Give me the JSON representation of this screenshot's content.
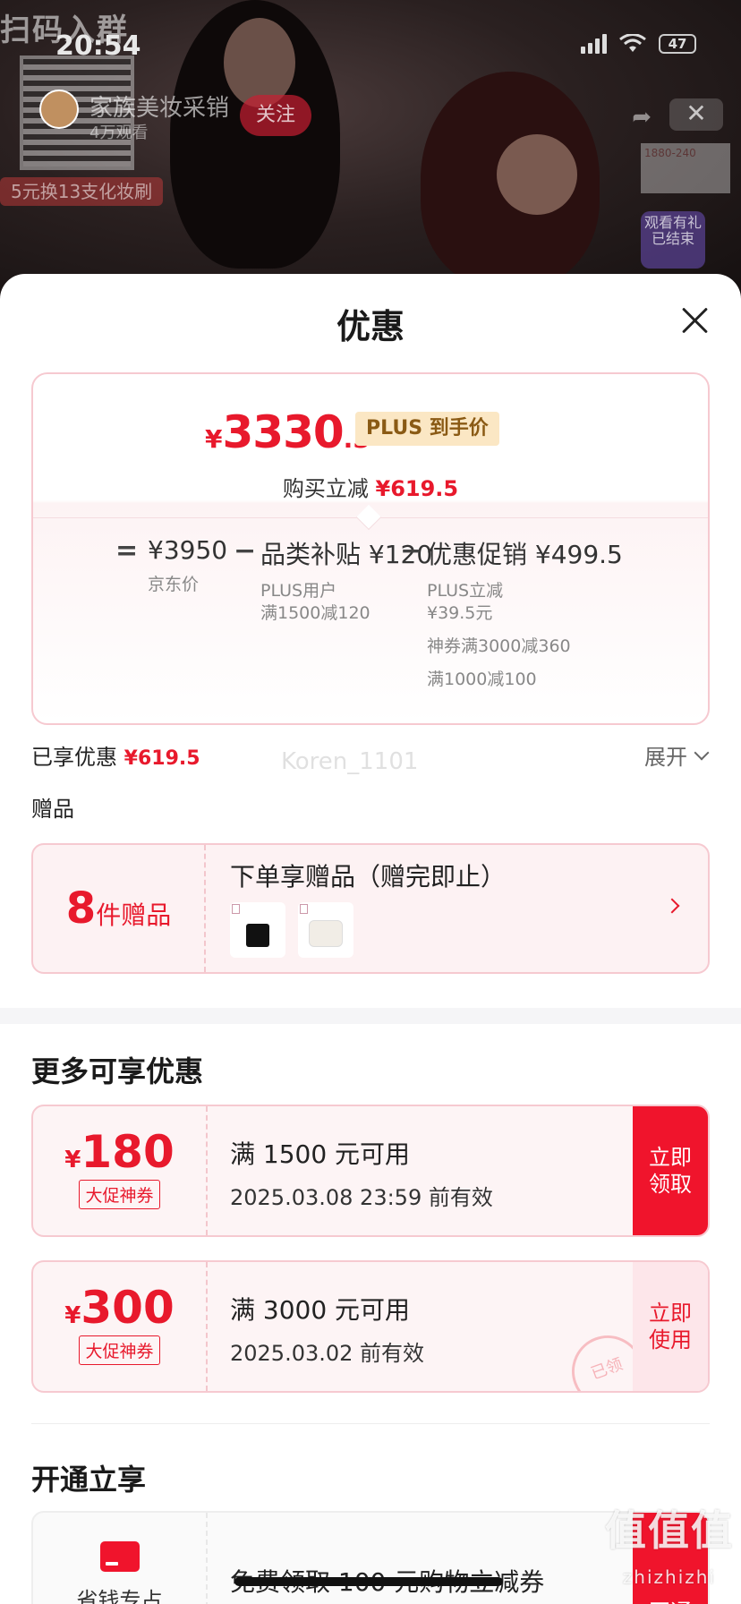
{
  "status_bar": {
    "time": "20:54",
    "battery": "47"
  },
  "stream": {
    "big_title": "扫码入群",
    "anchor_name": "家族美妆采销",
    "anchor_sub": "4万观看",
    "follow_label": "关注",
    "promo_tag": "5元换13支化妆刷",
    "close_label": "✕",
    "side_banner_text": "1880-240",
    "gift_badge_text": "观看有礼已结束"
  },
  "sheet": {
    "title": "优惠",
    "price": {
      "currency": "¥",
      "integer": "3330",
      "decimal": ".5",
      "plus_tag": "PLUS 到手价",
      "instant_label": "购买立减",
      "instant_value": "¥619.5"
    },
    "formula": {
      "eq": "=",
      "op": "−",
      "jd_price": "¥3950",
      "jd_price_label": "京东价",
      "subsidy": "品类补贴 ¥120",
      "subsidy_sub_1": "PLUS用户",
      "subsidy_sub_2": "满1500减120",
      "promo": "优惠促销 ¥499.5",
      "promo_sub_1": "PLUS立减",
      "promo_sub_2": "¥39.5元",
      "promo_sub_3": "神券满3000减360",
      "promo_sub_4": "满1000减100"
    },
    "enjoyed_label": "已享优惠",
    "enjoyed_value": "¥619.5",
    "expand_label": "展开",
    "watermark_user": "Koren_1101",
    "gifts_heading": "赠品",
    "gift_card": {
      "count": "8",
      "count_unit": "件赠品",
      "title": "下单享赠品（赠完即止）"
    },
    "more_heading": "更多可享优惠",
    "coupons": [
      {
        "currency": "¥",
        "amount": "180",
        "type": "大促神券",
        "condition": "满 1500 元可用",
        "validity": "2025.03.08 23:59 前有效",
        "button": "立即领取"
      },
      {
        "currency": "¥",
        "amount": "300",
        "type": "大促神券",
        "condition": "满 3000 元可用",
        "validity": "2025.03.02 前有效",
        "button": "立即使用",
        "stamp": "已领"
      }
    ],
    "open_heading": "开通立享",
    "open_card": {
      "left_label": "省钱专占",
      "text": "免费领取 100 元购物立减券",
      "button": "开通"
    }
  },
  "site_watermark": {
    "main": "值值值",
    "sub": "zhizhizhi"
  },
  "colors": {
    "accent_red": "#e8192c",
    "plus_gold_bg": "#fbe7c4",
    "plus_gold_text": "#8a5a14",
    "card_border_pink": "#f6c9d0"
  }
}
